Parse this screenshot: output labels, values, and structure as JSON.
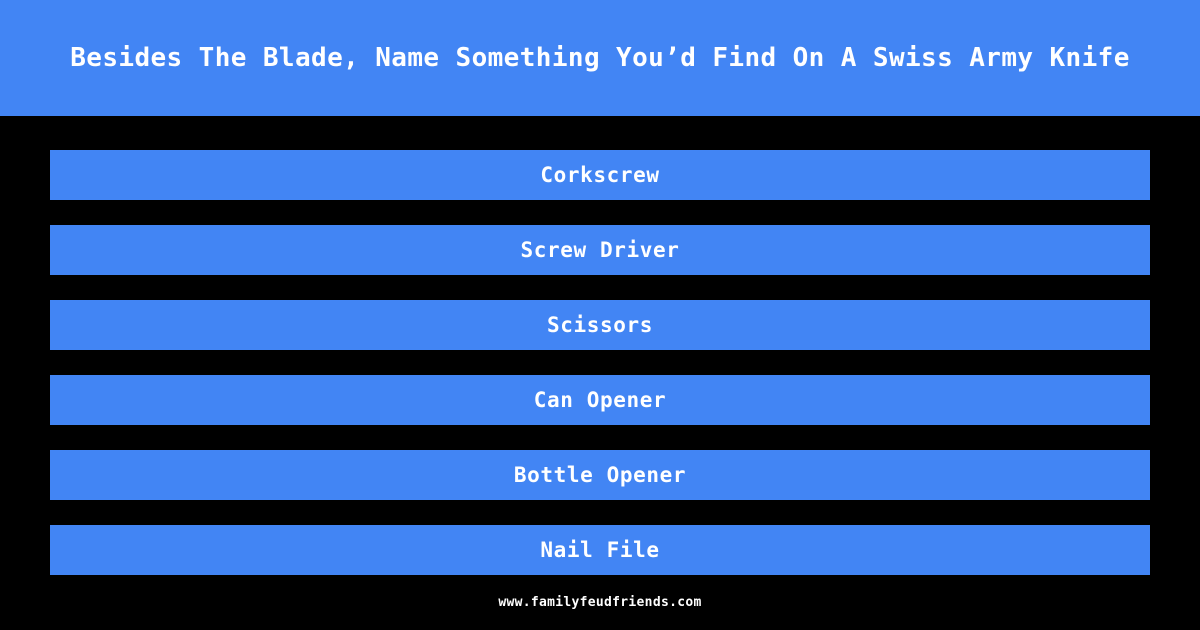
{
  "theme": {
    "accent_color": "#4285f4",
    "background_color": "#000000",
    "text_color": "#ffffff"
  },
  "header": {
    "question": "Besides The Blade, Name Something You’d Find On A Swiss Army Knife"
  },
  "answers": [
    {
      "label": "Corkscrew"
    },
    {
      "label": "Screw Driver"
    },
    {
      "label": "Scissors"
    },
    {
      "label": "Can Opener"
    },
    {
      "label": "Bottle Opener"
    },
    {
      "label": "Nail File"
    }
  ],
  "footer": {
    "site": "www.familyfeudfriends.com"
  }
}
